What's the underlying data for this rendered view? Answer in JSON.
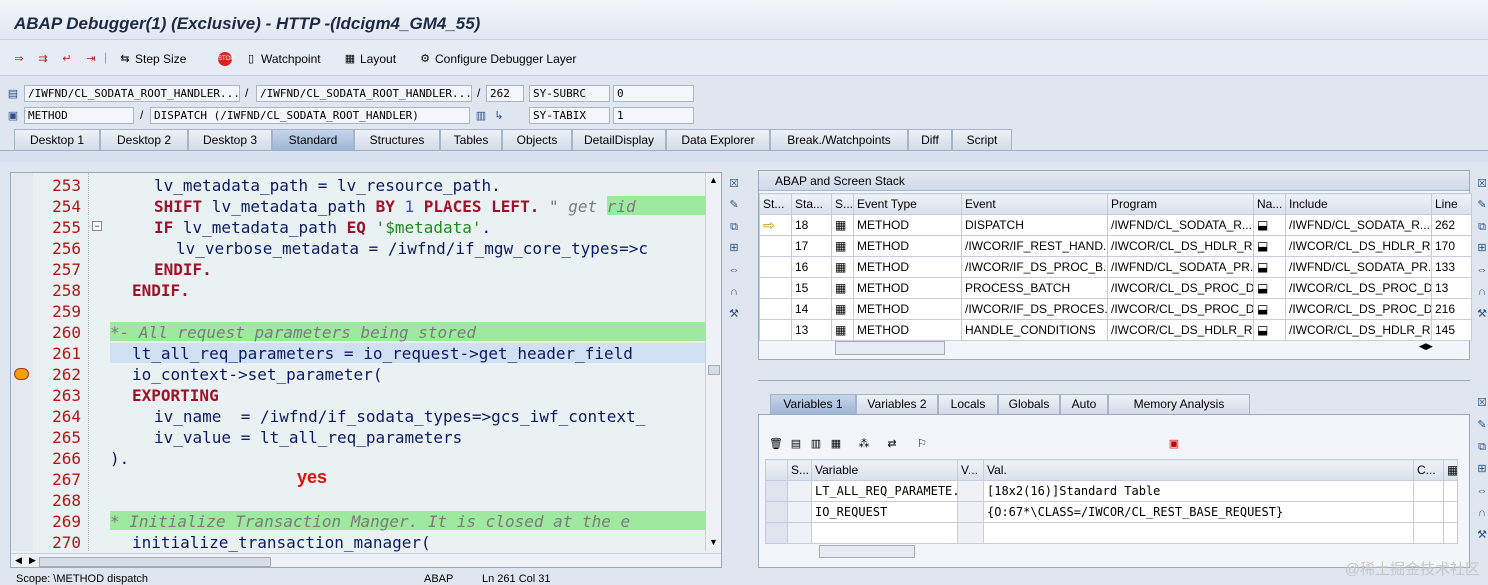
{
  "window": {
    "title": "ABAP Debugger(1)  (Exclusive) - HTTP -(ldcigm4_GM4_55)"
  },
  "toolbar": {
    "step_size": "Step Size",
    "watchpoint": "Watchpoint",
    "layout": "Layout",
    "configure": "Configure Debugger Layer"
  },
  "context": {
    "row1": {
      "program": "/IWFND/CL_SODATA_ROOT_HANDLER...",
      "include": "/IWFND/CL_SODATA_ROOT_HANDLER...",
      "line": "262",
      "sysfield": "SY-SUBRC",
      "sysvalue": "0"
    },
    "row2": {
      "type": "METHOD",
      "event": "DISPATCH (/IWFND/CL_SODATA_ROOT_HANDLER)",
      "sysfield": "SY-TABIX",
      "sysvalue": "1"
    },
    "separator": "/"
  },
  "tabs": [
    "Desktop 1",
    "Desktop 2",
    "Desktop 3",
    "Standard",
    "Structures",
    "Tables",
    "Objects",
    "DetailDisplay",
    "Data Explorer",
    "Break./Watchpoints",
    "Diff",
    "Script"
  ],
  "editor": {
    "line_numbers": [
      "253",
      "254",
      "255",
      "256",
      "257",
      "258",
      "259",
      "260",
      "261",
      "262",
      "263",
      "264",
      "265",
      "266",
      "267",
      "268",
      "269",
      "270"
    ],
    "annotation": "yes",
    "lines": {
      "l253": {
        "a": "lv_metadata_path = lv_resource_path."
      },
      "l254": {
        "kw1": "SHIFT",
        "a": " lv_metadata_path ",
        "kw2": "BY",
        "num": " 1 ",
        "kw3": "PLACES LEFT.",
        "cm": " \" get rid"
      },
      "l255": {
        "kw1": "IF",
        "a": " lv_metadata_path ",
        "kw2": "EQ",
        "str": " '$metadata'",
        "b": "."
      },
      "l256": {
        "a": "lv_verbose_metadata = /iwfnd/if_mgw_core_types=>c"
      },
      "l257": {
        "kw1": "ENDIF."
      },
      "l258": {
        "kw1": "ENDIF."
      },
      "l260": {
        "cm": "*- All request parameters being stored"
      },
      "l261": {
        "a": "lt_all_req_parameters = io_request->get_header_field"
      },
      "l262": {
        "a": "io_context->set_parameter("
      },
      "l263": {
        "kw1": "EXPORTING"
      },
      "l264": {
        "a": "iv_name  = /iwfnd/if_sodata_types=>gcs_iwf_context_"
      },
      "l265": {
        "a": "iv_value = lt_all_req_parameters"
      },
      "l266": {
        "a": ")."
      },
      "l269": {
        "cm": "* Initialize Transaction Manger. It is closed at the e"
      },
      "l270": {
        "a": "initialize_transaction_manager("
      }
    }
  },
  "status": {
    "scope": "Scope: \\METHOD dispatch",
    "lang": "ABAP",
    "pos": "Ln 261 Col 31"
  },
  "stack": {
    "title": "ABAP and Screen Stack",
    "headers": [
      "St...",
      "Sta...",
      "S...",
      "Event Type",
      "Event",
      "Program",
      "Na...",
      "Include",
      "Line"
    ],
    "rows": [
      [
        "18",
        "METHOD",
        "DISPATCH",
        "/IWFND/CL_SODATA_R...",
        "/IWFND/CL_SODATA_R...",
        "262"
      ],
      [
        "17",
        "METHOD",
        "/IWCOR/IF_REST_HAND...",
        "/IWCOR/CL_DS_HDLR_R...",
        "/IWCOR/CL_DS_HDLR_R...",
        "170"
      ],
      [
        "16",
        "METHOD",
        "/IWCOR/IF_DS_PROC_B...",
        "/IWFND/CL_SODATA_PR...",
        "/IWFND/CL_SODATA_PR...",
        "133"
      ],
      [
        "15",
        "METHOD",
        "PROCESS_BATCH",
        "/IWCOR/CL_DS_PROC_D...",
        "/IWCOR/CL_DS_PROC_D...",
        "13"
      ],
      [
        "14",
        "METHOD",
        "/IWCOR/IF_DS_PROCES...",
        "/IWCOR/CL_DS_PROC_D...",
        "/IWCOR/CL_DS_PROC_D...",
        "216"
      ],
      [
        "13",
        "METHOD",
        "HANDLE_CONDITIONS",
        "/IWCOR/CL_DS_HDLR_R...",
        "/IWCOR/CL_DS_HDLR_R...",
        "145"
      ]
    ]
  },
  "vartabs": [
    "Variables 1",
    "Variables 2",
    "Locals",
    "Globals",
    "Auto",
    "Memory Analysis"
  ],
  "vars": {
    "headers": [
      "S...",
      "Variable",
      "V...",
      "Val.",
      "C..."
    ],
    "rows": [
      [
        "LT_ALL_REQ_PARAMETE...",
        "[18x2(16)]Standard Table"
      ],
      [
        "IO_REQUEST",
        "{O:67*\\CLASS=/IWCOR/CL_REST_BASE_REQUEST}"
      ]
    ]
  },
  "watermark": "@稀土掘金技术社区"
}
